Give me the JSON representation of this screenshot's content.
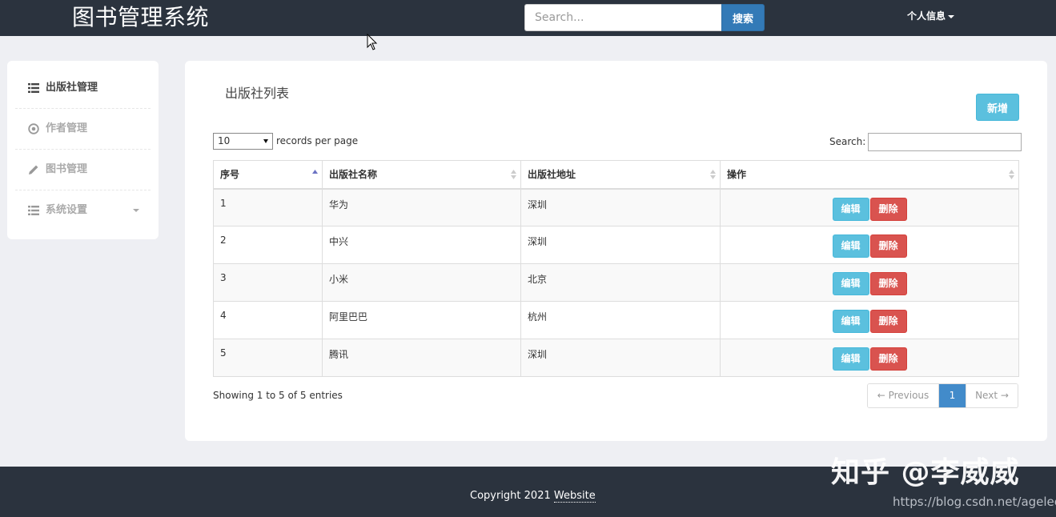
{
  "header": {
    "brand": "图书管理系统",
    "search_placeholder": "Search...",
    "search_button": "搜索",
    "user_menu": "个人信息"
  },
  "sidebar": {
    "items": [
      {
        "label": "出版社管理",
        "icon": "list-icon",
        "active": true
      },
      {
        "label": "作者管理",
        "icon": "circle-dot-icon",
        "active": false
      },
      {
        "label": "图书管理",
        "icon": "pencil-icon",
        "active": false
      },
      {
        "label": "系统设置",
        "icon": "list-icon",
        "active": false,
        "has_dropdown": true
      }
    ]
  },
  "panel": {
    "title": "出版社列表",
    "add_button": "新增",
    "length_value": "10",
    "length_suffix": "records per page",
    "search_label": "Search:",
    "columns": [
      "序号",
      "出版社名称",
      "出版社地址",
      "操作"
    ],
    "rows": [
      {
        "id": "1",
        "name": "华为",
        "address": "深圳"
      },
      {
        "id": "2",
        "name": "中兴",
        "address": "深圳"
      },
      {
        "id": "3",
        "name": "小米",
        "address": "北京"
      },
      {
        "id": "4",
        "name": "阿里巴巴",
        "address": "杭州"
      },
      {
        "id": "5",
        "name": "腾讯",
        "address": "深圳"
      }
    ],
    "edit_label": "编辑",
    "delete_label": "删除",
    "info": "Showing 1 to 5 of 5 entries",
    "pager": {
      "previous": "← Previous",
      "current": "1",
      "next": "Next →"
    }
  },
  "footer": {
    "copyright_prefix": "Copyright 2021 ",
    "copyright_link": "Website"
  },
  "watermark": {
    "zhihu": "知乎 @李威威",
    "url": "https://blog.csdn.net/agelee"
  },
  "colors": {
    "navbar": "#2b333e",
    "primary": "#337ab7",
    "info": "#5bc0de",
    "danger": "#d9534f",
    "page_active": "#428bca"
  }
}
